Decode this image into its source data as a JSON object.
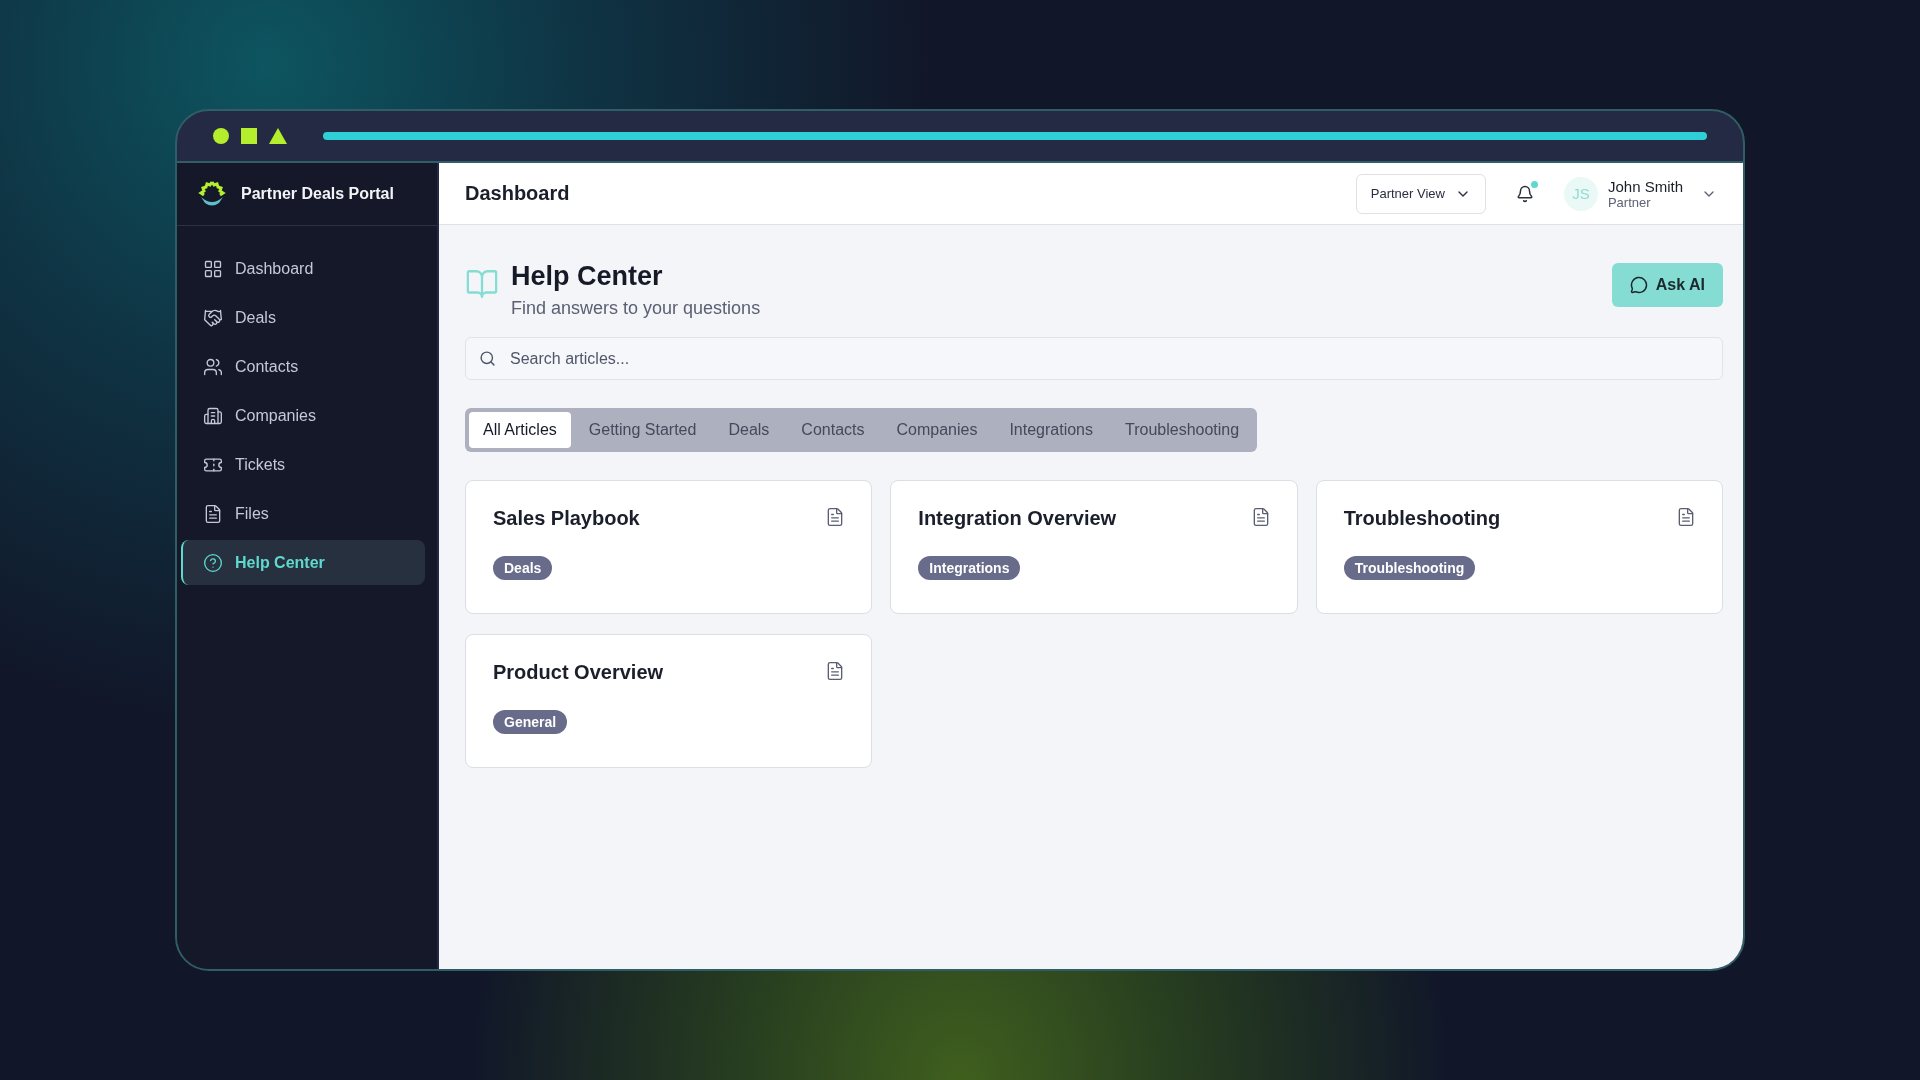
{
  "app": {
    "name": "Partner Deals Portal"
  },
  "sidebar": {
    "items": [
      {
        "label": "Dashboard",
        "selected": false
      },
      {
        "label": "Deals",
        "selected": false
      },
      {
        "label": "Contacts",
        "selected": false
      },
      {
        "label": "Companies",
        "selected": false
      },
      {
        "label": "Tickets",
        "selected": false
      },
      {
        "label": "Files",
        "selected": false
      },
      {
        "label": "Help Center",
        "selected": true
      }
    ]
  },
  "header": {
    "title": "Dashboard",
    "view_select": "Partner View",
    "has_notification": true,
    "user": {
      "initials": "JS",
      "name": "John Smith",
      "role": "Partner"
    }
  },
  "page": {
    "title": "Help Center",
    "subtitle": "Find answers to your questions",
    "ask_button": "Ask AI"
  },
  "search": {
    "placeholder": "Search articles..."
  },
  "tabs": [
    {
      "label": "All Articles",
      "selected": true
    },
    {
      "label": "Getting Started",
      "selected": false
    },
    {
      "label": "Deals",
      "selected": false
    },
    {
      "label": "Contacts",
      "selected": false
    },
    {
      "label": "Companies",
      "selected": false
    },
    {
      "label": "Integrations",
      "selected": false
    },
    {
      "label": "Troubleshooting",
      "selected": false
    }
  ],
  "articles": [
    {
      "title": "Sales Playbook",
      "tag": "Deals"
    },
    {
      "title": "Integration Overview",
      "tag": "Integrations"
    },
    {
      "title": "Troubleshooting",
      "tag": "Troubleshooting"
    },
    {
      "title": "Product Overview",
      "tag": "General"
    }
  ]
}
